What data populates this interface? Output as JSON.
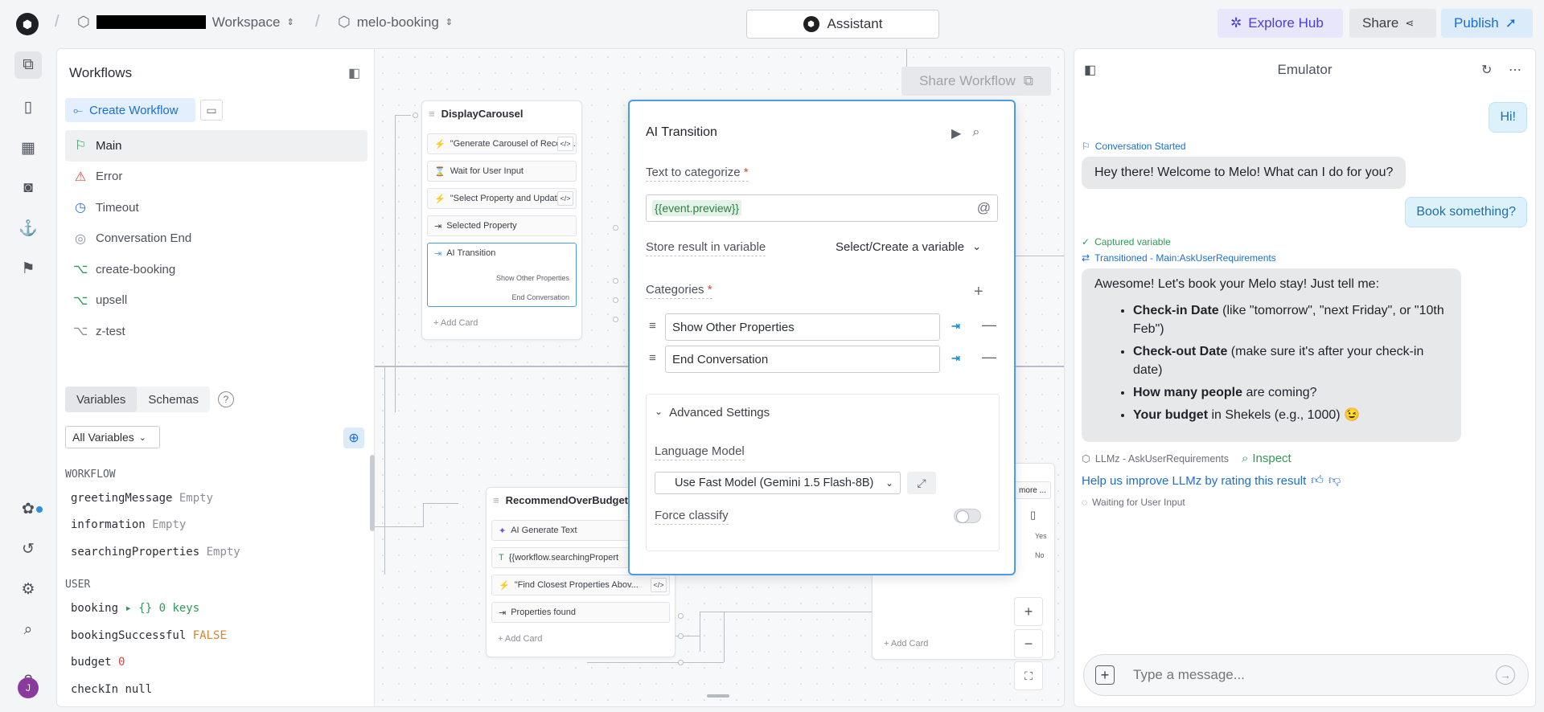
{
  "topbar": {
    "workspace_label": "Workspace",
    "project_label": "melo-booking",
    "assistant_label": "Assistant",
    "explore_label": "Explore Hub",
    "share_label": "Share",
    "publish_label": "Publish"
  },
  "workflows": {
    "title": "Workflows",
    "create_label": "Create Workflow",
    "items": [
      {
        "label": "Main",
        "icon": "flag-icon"
      },
      {
        "label": "Error",
        "icon": "warning-icon"
      },
      {
        "label": "Timeout",
        "icon": "clock-icon"
      },
      {
        "label": "Conversation End",
        "icon": "stop-icon"
      },
      {
        "label": "create-booking",
        "icon": "branch-icon"
      },
      {
        "label": "upsell",
        "icon": "branch-icon"
      },
      {
        "label": "z-test",
        "icon": "branch-icon"
      }
    ]
  },
  "variables": {
    "tab_variables": "Variables",
    "tab_schemas": "Schemas",
    "filter_label": "All Variables",
    "workflow_section": "WORKFLOW",
    "user_section": "USER",
    "workflow_vars": [
      {
        "name": "greetingMessage",
        "value": "Empty"
      },
      {
        "name": "information",
        "value": "Empty"
      },
      {
        "name": "searchingProperties",
        "value": "Empty"
      }
    ],
    "user_vars": [
      {
        "name": "booking",
        "value": "▸ {} 0 keys"
      },
      {
        "name": "bookingSuccessful",
        "value": "FALSE"
      },
      {
        "name": "budget",
        "value": "0"
      },
      {
        "name": "checkIn",
        "value": "null"
      }
    ]
  },
  "canvas": {
    "share_workflow_label": "Share Workflow",
    "node1": {
      "title": "DisplayCarousel",
      "cards": [
        "\"Generate Carousel of Recom...",
        "Wait for User Input",
        "\"Select Property and Update ...",
        "Selected Property",
        "AI Transition"
      ],
      "ai_outputs": [
        "Show Other Properties",
        "End Conversation"
      ],
      "add_card": "Add Card"
    },
    "node2": {
      "title": "RecommendOverBudget",
      "cards": [
        "AI Generate Text",
        "{{workflow.searchingPropert",
        "\"Find Closest Properties Abov...",
        "Properties found"
      ],
      "add_card": "Add Card"
    },
    "node3": {
      "more_label": "more ...",
      "outputs": [
        "Yes",
        "No"
      ],
      "add_card": "Add Card"
    }
  },
  "ai_transition": {
    "title": "AI Transition",
    "text_label": "Text to categorize",
    "text_value": "{{event.preview}}",
    "store_label": "Store result in variable",
    "store_value": "Select/Create a variable",
    "categories_label": "Categories",
    "categories": [
      "Show Other Properties",
      "End Conversation"
    ],
    "advanced_label": "Advanced Settings",
    "model_label": "Language Model",
    "model_value": "Use Fast Model (Gemini 1.5 Flash-8B)",
    "force_label": "Force classify",
    "force_on": false
  },
  "emulator": {
    "title": "Emulator",
    "msg_user1": "Hi!",
    "evt_started": "Conversation Started",
    "msg_bot1": "Hey there! Welcome to Melo! What can I do for you?",
    "msg_user2": "Book something?",
    "evt_captured": "Captured variable",
    "evt_transitioned": "Transitioned - Main:AskUserRequirements",
    "msg_bot2_intro": "Awesome! Let's book your Melo stay! Just tell me:",
    "msg_bot2_items": [
      {
        "bold": "Check-in Date",
        "rest": " (like \"tomorrow\", \"next Friday\", or \"10th Feb\")"
      },
      {
        "bold": "Check-out Date",
        "rest": " (make sure it's after your check-in date)"
      },
      {
        "bold": "How many people",
        "rest": " are coming?"
      },
      {
        "bold": "Your budget",
        "rest": " in Shekels (e.g., 1000) 😉"
      }
    ],
    "evt_llmz": "LLMz - AskUserRequirements",
    "inspect_label": "Inspect",
    "rating_text": "Help us improve LLMz by rating this result",
    "evt_waiting": "Waiting for User Input",
    "input_placeholder": "Type a message..."
  },
  "user": {
    "avatar_initial": "J"
  }
}
